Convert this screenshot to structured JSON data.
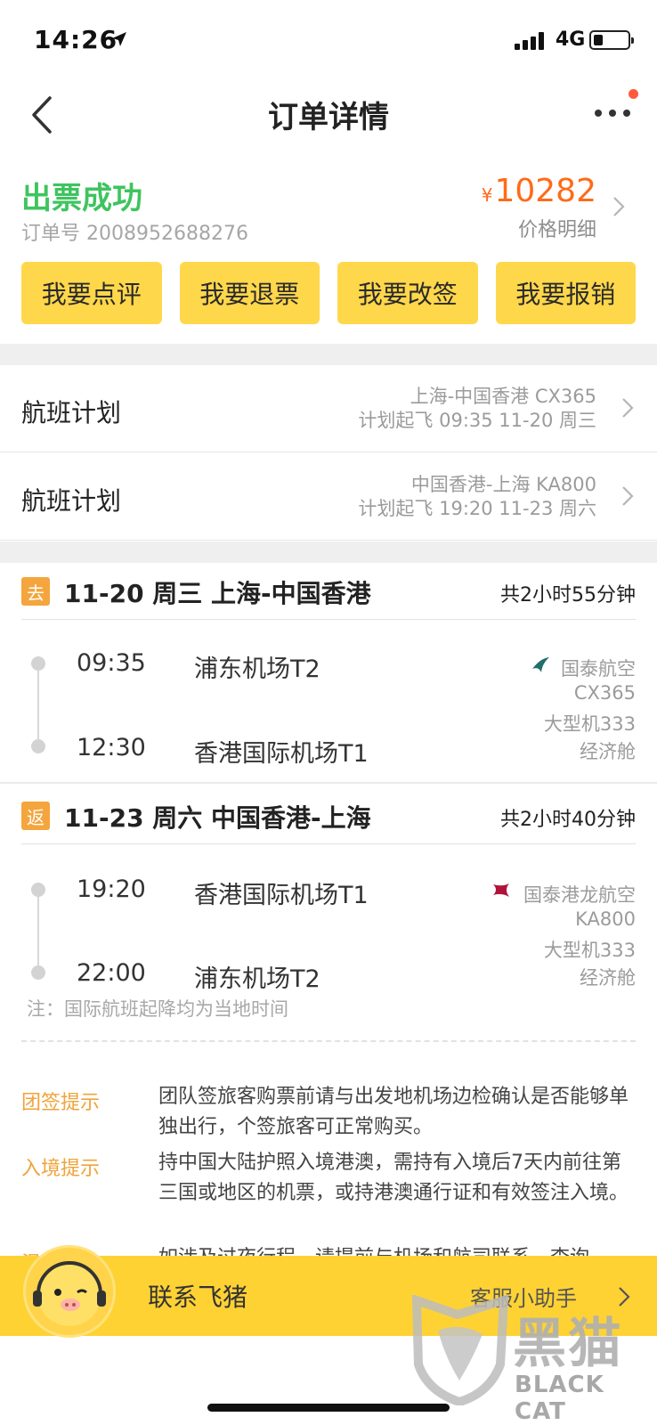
{
  "status_bar": {
    "time": "14:26",
    "network": "4G"
  },
  "nav": {
    "title": "订单详情"
  },
  "order": {
    "status": "出票成功",
    "order_no": "订单号 2008952688276",
    "currency": "¥",
    "price": "10282",
    "price_detail": "价格明细"
  },
  "actions": [
    {
      "label": "我要点评"
    },
    {
      "label": "我要退票"
    },
    {
      "label": "我要改签"
    },
    {
      "label": "我要报销"
    }
  ],
  "flight_plans": [
    {
      "label": "航班计划",
      "route": "上海-中国香港 CX365",
      "schedule": "计划起飞 09:35 11-20 周三"
    },
    {
      "label": "航班计划",
      "route": "中国香港-上海 KA800",
      "schedule": "计划起飞 19:20 11-23 周六"
    }
  ],
  "segments": [
    {
      "tag": "去",
      "title": "11-20 周三 上海-中国香港",
      "duration": "共2小时55分钟",
      "depart_time": "09:35",
      "depart_airport": "浦东机场T2",
      "arrive_time": "12:30",
      "arrive_airport": "香港国际机场T1",
      "airline": "国泰航空",
      "flight_no": "CX365",
      "aircraft": "大型机333",
      "cabin": "经济舱",
      "logo_color": "#1f6f6a"
    },
    {
      "tag": "返",
      "title": "11-23 周六 中国香港-上海",
      "duration": "共2小时40分钟",
      "depart_time": "19:20",
      "depart_airport": "香港国际机场T1",
      "arrive_time": "22:00",
      "arrive_airport": "浦东机场T2",
      "airline": "国泰港龙航空",
      "flight_no": "KA800",
      "aircraft": "大型机333",
      "cabin": "经济舱",
      "logo_color": "#b1123b"
    }
  ],
  "note": "注：国际航班起降均为当地时间",
  "tips": [
    {
      "label": "团签提示",
      "text": "团队签旅客购票前请与出发地机场边检确认是否能够单独出行，个签旅客可正常购买。"
    },
    {
      "label": "入境提示",
      "text": "持中国大陆护照入境港澳，需持有入境后7天内前往第三国或地区的机票，或持港澳通行证和有效签注入境。"
    },
    {
      "label": "温馨提示",
      "text": "如涉及过夜行程，请提前与机场和航司联系，查询"
    }
  ],
  "bottom_bar": {
    "contact": "联系飞猪",
    "assistant": "客服小助手"
  },
  "watermark": {
    "cn": "黑猫",
    "en": "BLACK CAT"
  },
  "colors": {
    "accent_yellow": "#ffd74a",
    "success_green": "#3ec45f",
    "price_orange": "#ff6a18",
    "tip_orange": "#f0a33a"
  }
}
